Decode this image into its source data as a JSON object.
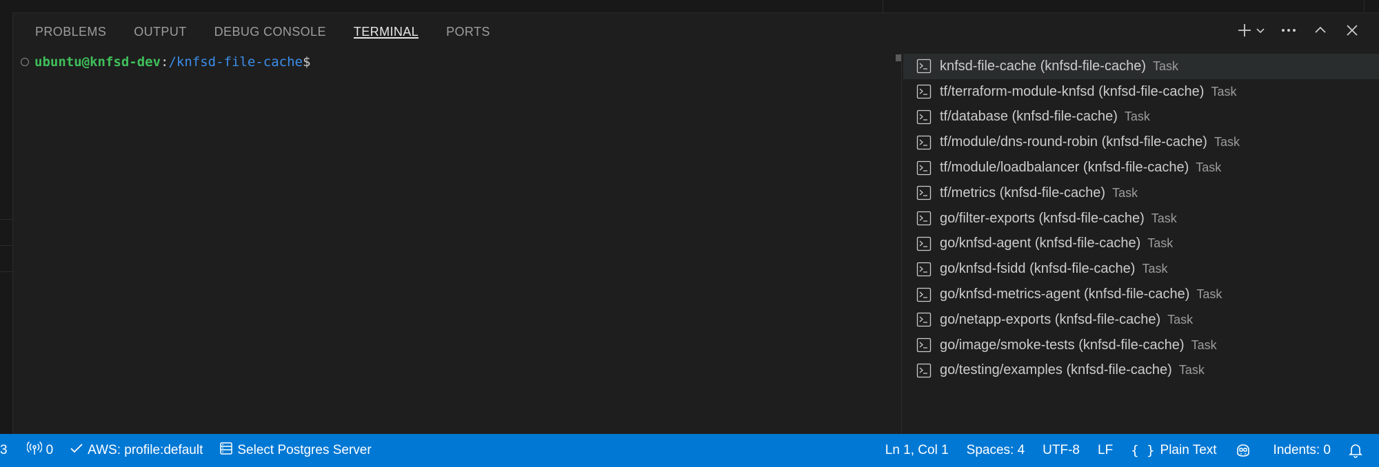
{
  "panel": {
    "tabs": [
      {
        "label": "PROBLEMS",
        "active": false
      },
      {
        "label": "OUTPUT",
        "active": false
      },
      {
        "label": "DEBUG CONSOLE",
        "active": false
      },
      {
        "label": "TERMINAL",
        "active": true
      },
      {
        "label": "PORTS",
        "active": false
      }
    ],
    "actions": [
      "plus-icon",
      "chevron-down-icon",
      "ellipsis-icon",
      "chevron-up-icon",
      "close-icon"
    ]
  },
  "terminal": {
    "user_host": "ubuntu@knfsd-dev",
    "colon": ":",
    "path": "/knfsd-file-cache",
    "prompt": "$"
  },
  "terminal_list": {
    "items": [
      {
        "name": "knfsd-file-cache (knfsd-file-cache)",
        "kind": "Task",
        "selected": true
      },
      {
        "name": "tf/terraform-module-knfsd (knfsd-file-cache)",
        "kind": "Task"
      },
      {
        "name": "tf/database (knfsd-file-cache)",
        "kind": "Task"
      },
      {
        "name": "tf/module/dns-round-robin (knfsd-file-cache)",
        "kind": "Task"
      },
      {
        "name": "tf/module/loadbalancer (knfsd-file-cache)",
        "kind": "Task"
      },
      {
        "name": "tf/metrics (knfsd-file-cache)",
        "kind": "Task"
      },
      {
        "name": "go/filter-exports (knfsd-file-cache)",
        "kind": "Task"
      },
      {
        "name": "go/knfsd-agent (knfsd-file-cache)",
        "kind": "Task"
      },
      {
        "name": "go/knfsd-fsidd (knfsd-file-cache)",
        "kind": "Task"
      },
      {
        "name": "go/knfsd-metrics-agent (knfsd-file-cache)",
        "kind": "Task"
      },
      {
        "name": "go/netapp-exports (knfsd-file-cache)",
        "kind": "Task"
      },
      {
        "name": "go/image/smoke-tests (knfsd-file-cache)",
        "kind": "Task"
      },
      {
        "name": "go/testing/examples (knfsd-file-cache)",
        "kind": "Task"
      }
    ]
  },
  "statusbar": {
    "left": {
      "count": "3",
      "ports": "0",
      "aws": "AWS: profile:default",
      "postgres": "Select Postgres Server"
    },
    "right": {
      "position": "Ln 1, Col 1",
      "spaces": "Spaces: 4",
      "encoding": "UTF-8",
      "eol": "LF",
      "language": "Plain Text",
      "indents": "Indents: 0"
    }
  },
  "colors": {
    "statusbar": "#0078d4",
    "panel_bg": "#1e1e1e",
    "prompt_user": "#3fbf5a",
    "prompt_path": "#3b8eea"
  }
}
